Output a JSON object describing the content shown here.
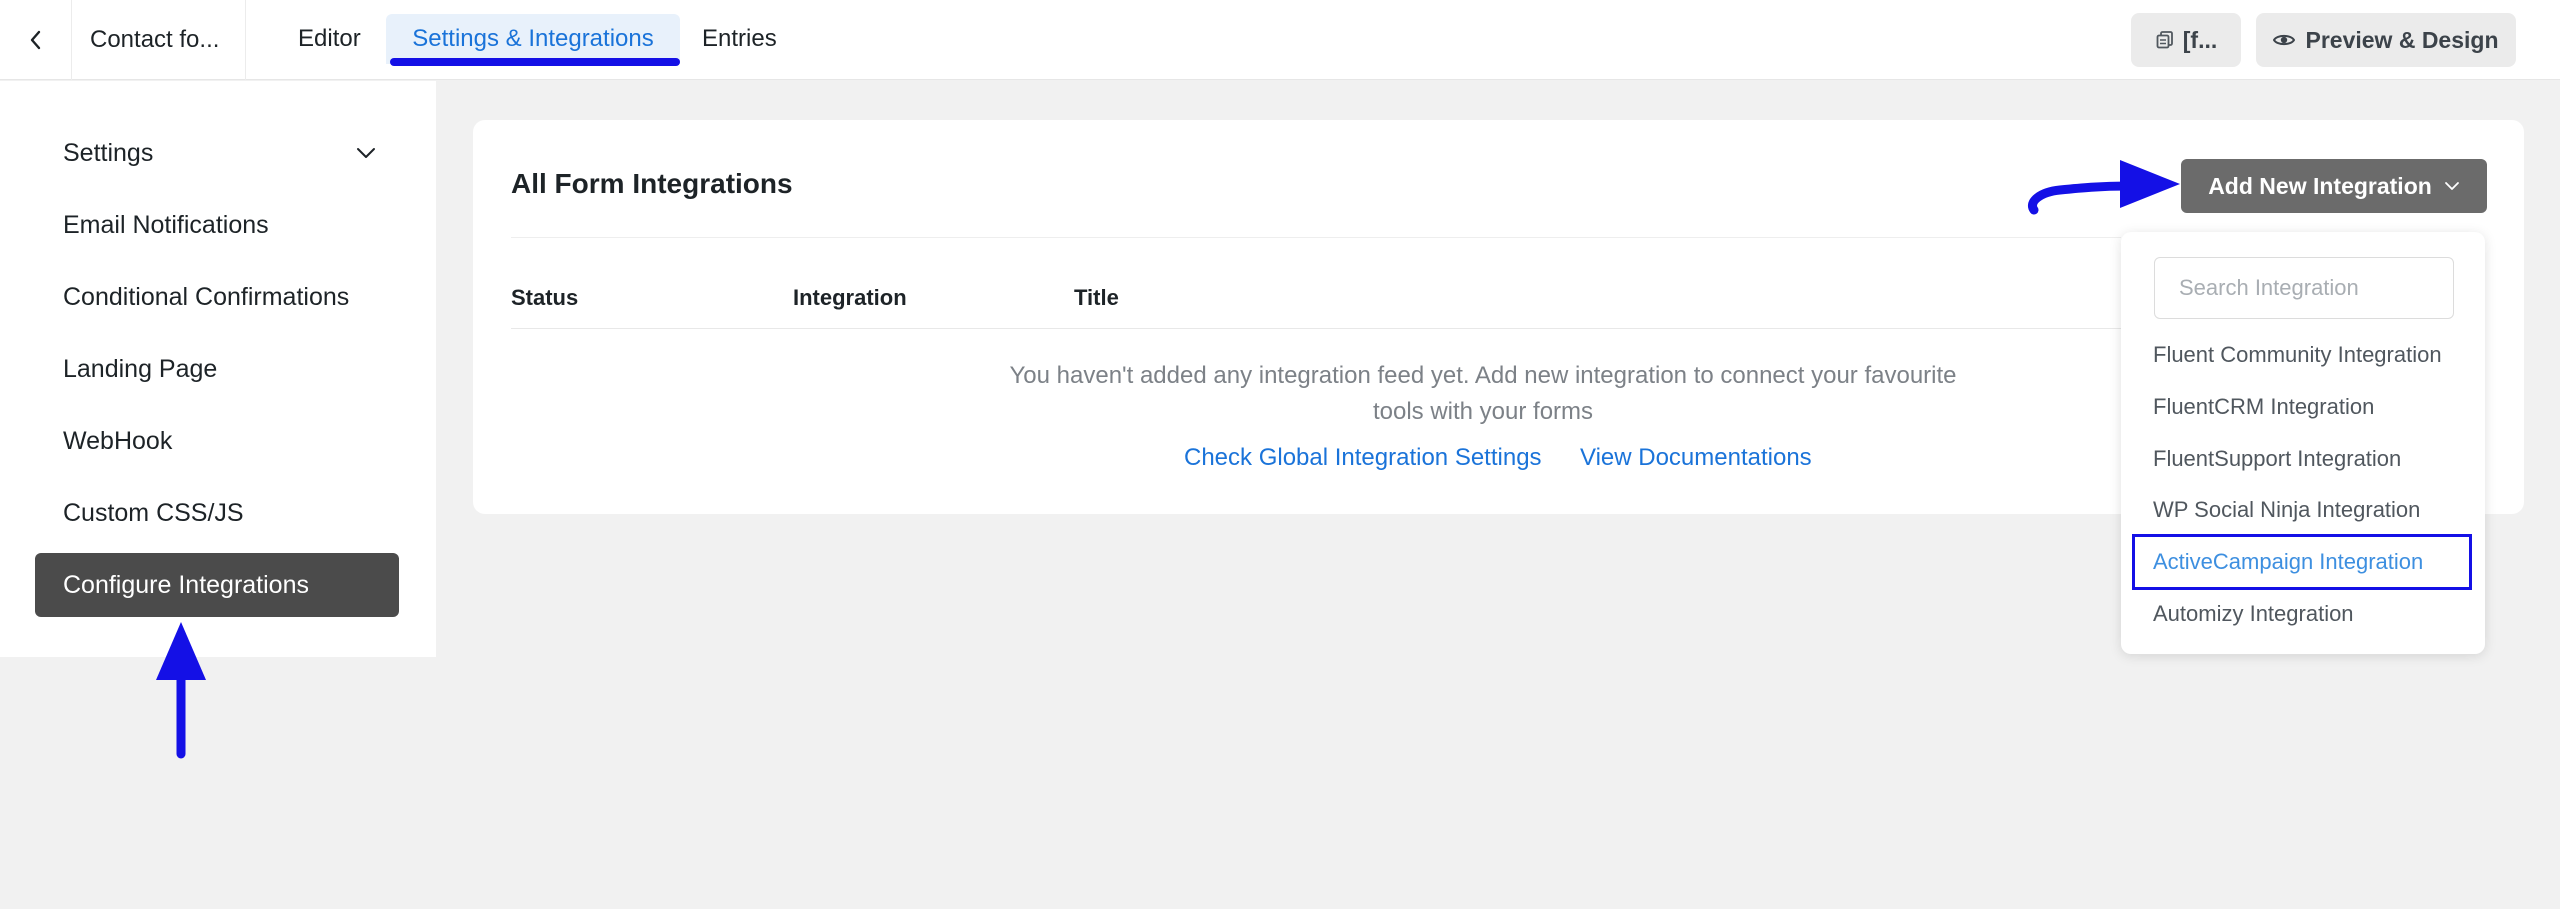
{
  "header": {
    "form_title": "Contact fo...",
    "tabs": [
      {
        "label": "Editor"
      },
      {
        "label": "Settings & Integrations"
      },
      {
        "label": "Entries"
      }
    ],
    "shortcode_label": "[f...",
    "preview_label": "Preview & Design"
  },
  "sidebar": {
    "items": [
      {
        "label": "Settings"
      },
      {
        "label": "Email Notifications"
      },
      {
        "label": "Conditional Confirmations"
      },
      {
        "label": "Landing Page"
      },
      {
        "label": "WebHook"
      },
      {
        "label": "Custom CSS/JS"
      },
      {
        "label": "Configure Integrations"
      }
    ]
  },
  "main": {
    "title": "All Form Integrations",
    "add_button_label": "Add New Integration",
    "columns": [
      "Status",
      "Integration",
      "Title"
    ],
    "empty_message": "You haven't added any integration feed yet. Add new integration to connect your favourite tools with your forms",
    "links": {
      "global_settings": "Check Global Integration Settings",
      "documentation": "View Documentations"
    }
  },
  "dropdown": {
    "search_placeholder": "Search Integration",
    "items": [
      {
        "label": "Fluent Community Integration"
      },
      {
        "label": "FluentCRM Integration"
      },
      {
        "label": "FluentSupport Integration"
      },
      {
        "label": "WP Social Ninja Integration"
      },
      {
        "label": "ActiveCampaign Integration"
      },
      {
        "label": "Automizy Integration"
      }
    ]
  },
  "colors": {
    "accent": "#1a73d9",
    "annotation": "#1410e6",
    "active_sidebar": "#4b4b4b",
    "add_button": "#6b6b6b"
  },
  "icons": {
    "back": "chevron-left-icon",
    "shortcode": "copy-icon",
    "preview": "eye-icon",
    "settings_toggle": "chevron-down-icon",
    "add_button": "chevron-down-icon"
  }
}
